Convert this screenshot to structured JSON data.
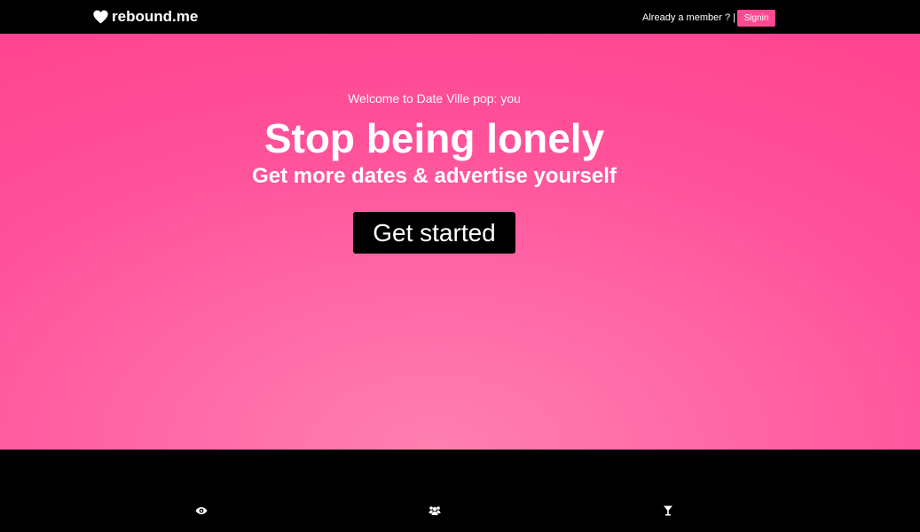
{
  "nav": {
    "brand_name": "rebound.me",
    "brand_icon": "heart-icon",
    "member_text": "Already a member ? |",
    "signin_label": "Signin"
  },
  "hero": {
    "welcome": "Welcome to Date Ville pop: you",
    "title": "Stop being lonely",
    "subtitle": "Get more dates & advertise yourself",
    "cta_label": "Get started"
  },
  "features": {
    "icons": [
      "eye-icon",
      "group-icon",
      "cocktail-icon"
    ]
  },
  "colors": {
    "accent": "#ff4992",
    "hero_top": "#ff4590",
    "hero_glow": "#ff80b0",
    "dark": "#000000",
    "text": "#ffffff"
  }
}
